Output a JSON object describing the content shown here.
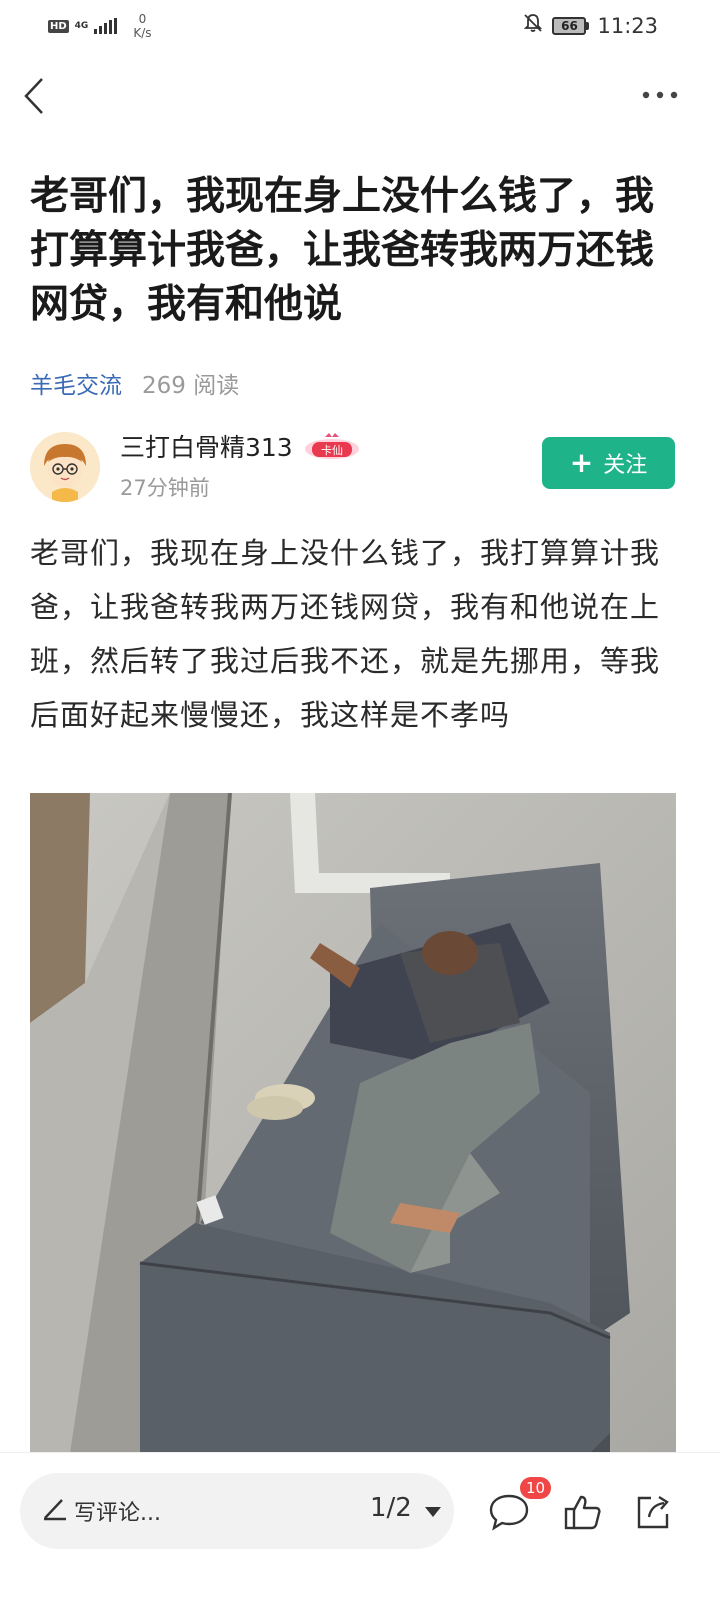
{
  "status_bar": {
    "hd": "HD",
    "network": "4G",
    "speed_value": "0",
    "speed_unit": "K/s",
    "battery": "66",
    "time": "11:23"
  },
  "post": {
    "title": "老哥们，我现在身上没什么钱了，我打算算计我爸，让我爸转我两万还钱网贷，我有和他说",
    "category": "羊毛交流",
    "reads": "269 阅读",
    "author": {
      "name": "三打白骨精313",
      "badge": "卡仙",
      "time": "27分钟前",
      "follow_label": "关注"
    },
    "body": "老哥们，我现在身上没什么钱了，我打算算计我爸，让我爸转我两万还钱网贷，我有和他说在上班，然后转了我过后我不还，就是先挪用，等我后面好起来慢慢还，我这样是不孝吗"
  },
  "bottom_bar": {
    "comment_placeholder": "写评论...",
    "page_indicator": "1/2",
    "comment_count": "10"
  },
  "colors": {
    "accent": "#1fb389",
    "link": "#3c6bb5",
    "badge": "#f04646"
  }
}
